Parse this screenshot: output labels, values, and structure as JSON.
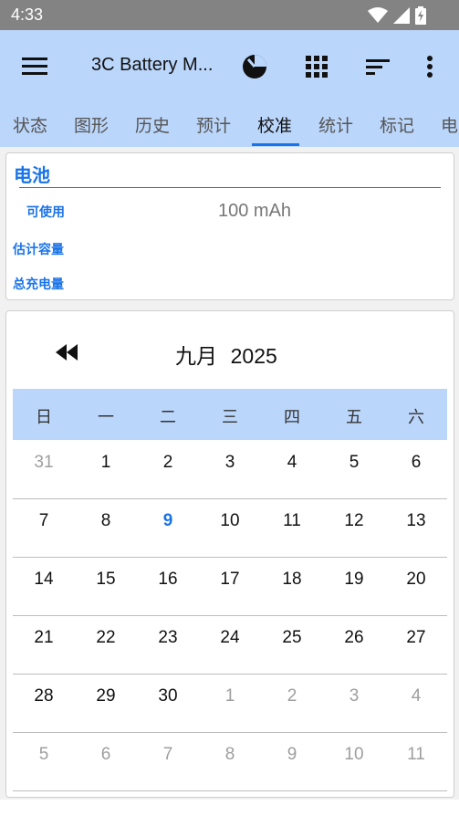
{
  "status_bar": {
    "time": "4:33"
  },
  "app_bar": {
    "title": "3C Battery M..."
  },
  "tabs": [
    {
      "label": "状态"
    },
    {
      "label": "图形"
    },
    {
      "label": "历史"
    },
    {
      "label": "预计"
    },
    {
      "label": "校准"
    },
    {
      "label": "统计"
    },
    {
      "label": "标记"
    },
    {
      "label": "电"
    }
  ],
  "active_tab": "校准",
  "battery": {
    "title": "电池",
    "rows": [
      {
        "label": "可使用",
        "value": "100 mAh"
      },
      {
        "label": "估计容量",
        "value": ""
      },
      {
        "label": "总充电量",
        "value": ""
      }
    ]
  },
  "calendar": {
    "month": "九月",
    "year": "2025",
    "weekdays": [
      "日",
      "一",
      "二",
      "三",
      "四",
      "五",
      "六"
    ],
    "weeks": [
      [
        "31",
        "1",
        "2",
        "3",
        "4",
        "5",
        "6"
      ],
      [
        "7",
        "8",
        "9",
        "10",
        "11",
        "12",
        "13"
      ],
      [
        "14",
        "15",
        "16",
        "17",
        "18",
        "19",
        "20"
      ],
      [
        "21",
        "22",
        "23",
        "24",
        "25",
        "26",
        "27"
      ],
      [
        "28",
        "29",
        "30",
        "1",
        "2",
        "3",
        "4"
      ],
      [
        "5",
        "6",
        "7",
        "8",
        "9",
        "10",
        "11"
      ]
    ],
    "today": "9"
  },
  "colors": {
    "accent": "#1a73e8",
    "bar": "#bbd6fb",
    "statusbar": "#838383"
  }
}
